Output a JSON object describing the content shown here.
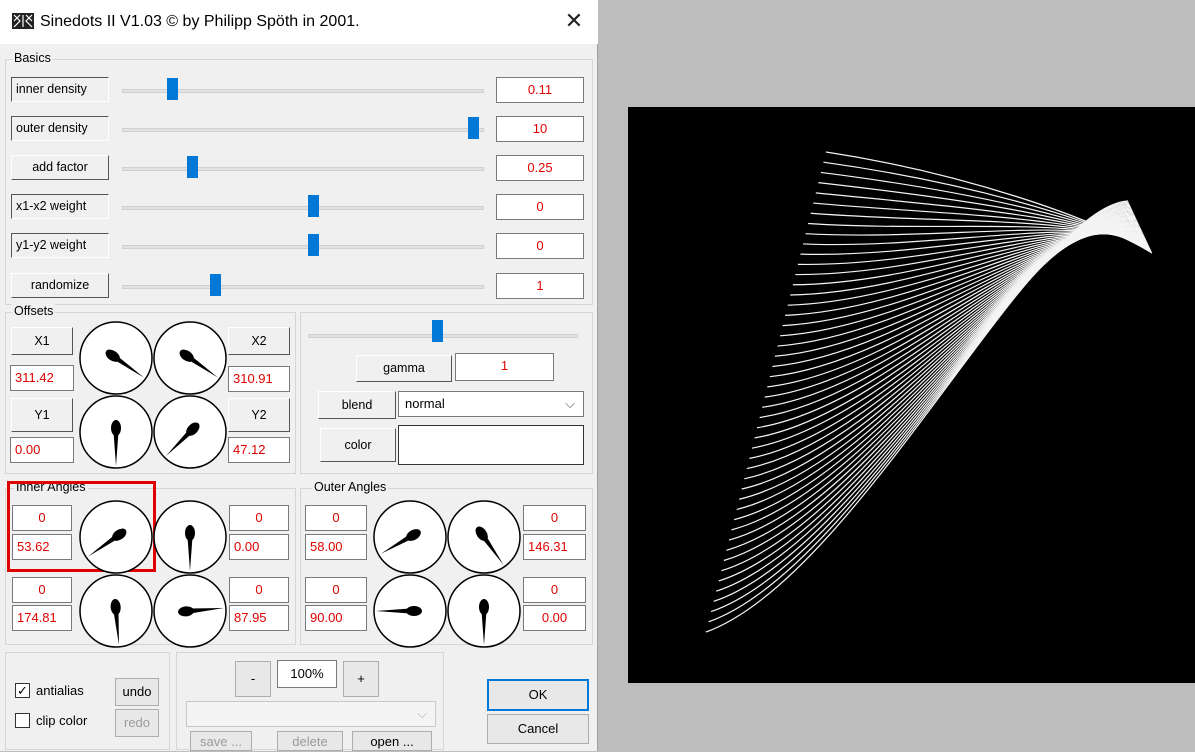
{
  "window": {
    "title": "Sinedots II V1.03 © by Philipp Spöth in 2001.",
    "close_glyph": "✕"
  },
  "basics": {
    "group_label": "Basics",
    "rows": [
      {
        "label": "inner density",
        "value": "0.11",
        "slider": 0.08
      },
      {
        "label": "outer density",
        "value": "10",
        "slider": 1.0
      },
      {
        "label": "add factor",
        "value": "0.25",
        "slider": 0.14
      },
      {
        "label": "x1-x2 weight",
        "value": "0",
        "slider": 0.51
      },
      {
        "label": "y1-y2 weight",
        "value": "0",
        "slider": 0.51
      },
      {
        "label": "randomize",
        "value": "1",
        "slider": 0.21
      }
    ]
  },
  "offsets": {
    "group_label": "Offsets",
    "x1_label": "X1",
    "x1_value": "311.42",
    "x2_label": "X2",
    "x2_value": "310.91",
    "y1_label": "Y1",
    "y1_value": "0.00",
    "y2_label": "Y2",
    "y2_value": "47.12"
  },
  "render": {
    "gamma_label": "gamma",
    "gamma_value": "1",
    "gamma_slider": 0.5,
    "blend_label": "blend",
    "blend_value": "normal",
    "color_label": "color"
  },
  "inner_angles": {
    "group_label": "Inner Angles",
    "a_top": "0",
    "a_bottom": "53.62",
    "b_top": "0",
    "b_bottom": "0.00",
    "c_top": "0",
    "c_bottom": "174.81",
    "d_top": "0",
    "d_bottom": "87.95"
  },
  "outer_angles": {
    "group_label": "Outer Angles",
    "a_top": "0",
    "a_bottom": "58.00",
    "b_top": "0",
    "b_bottom": "146.31",
    "c_top": "0",
    "c_bottom": "90.00",
    "d_top": "0",
    "d_bottom": "0.00"
  },
  "bottom": {
    "antialias_label": "antialias",
    "antialias_checked": true,
    "clip_color_label": "clip color",
    "clip_color_checked": false,
    "undo_label": "undo",
    "redo_label": "redo",
    "zoom_minus": "-",
    "zoom_value": "100%",
    "zoom_plus": "+",
    "save_label": "save ...",
    "delete_label": "delete",
    "open_label": "open ...",
    "ok_label": "OK",
    "cancel_label": "Cancel"
  },
  "dials": [
    {
      "id": "offset-x1",
      "angle": 125
    },
    {
      "id": "offset-x2",
      "angle": 125
    },
    {
      "id": "offset-y1",
      "angle": 180
    },
    {
      "id": "offset-y2",
      "angle": 225
    },
    {
      "id": "inner-a",
      "angle": 235
    },
    {
      "id": "inner-b",
      "angle": 180
    },
    {
      "id": "inner-c",
      "angle": 175
    },
    {
      "id": "inner-d",
      "angle": 85
    },
    {
      "id": "outer-a",
      "angle": 240
    },
    {
      "id": "outer-b",
      "angle": 145
    },
    {
      "id": "outer-c",
      "angle": 270
    },
    {
      "id": "outer-d",
      "angle": 180
    }
  ]
}
